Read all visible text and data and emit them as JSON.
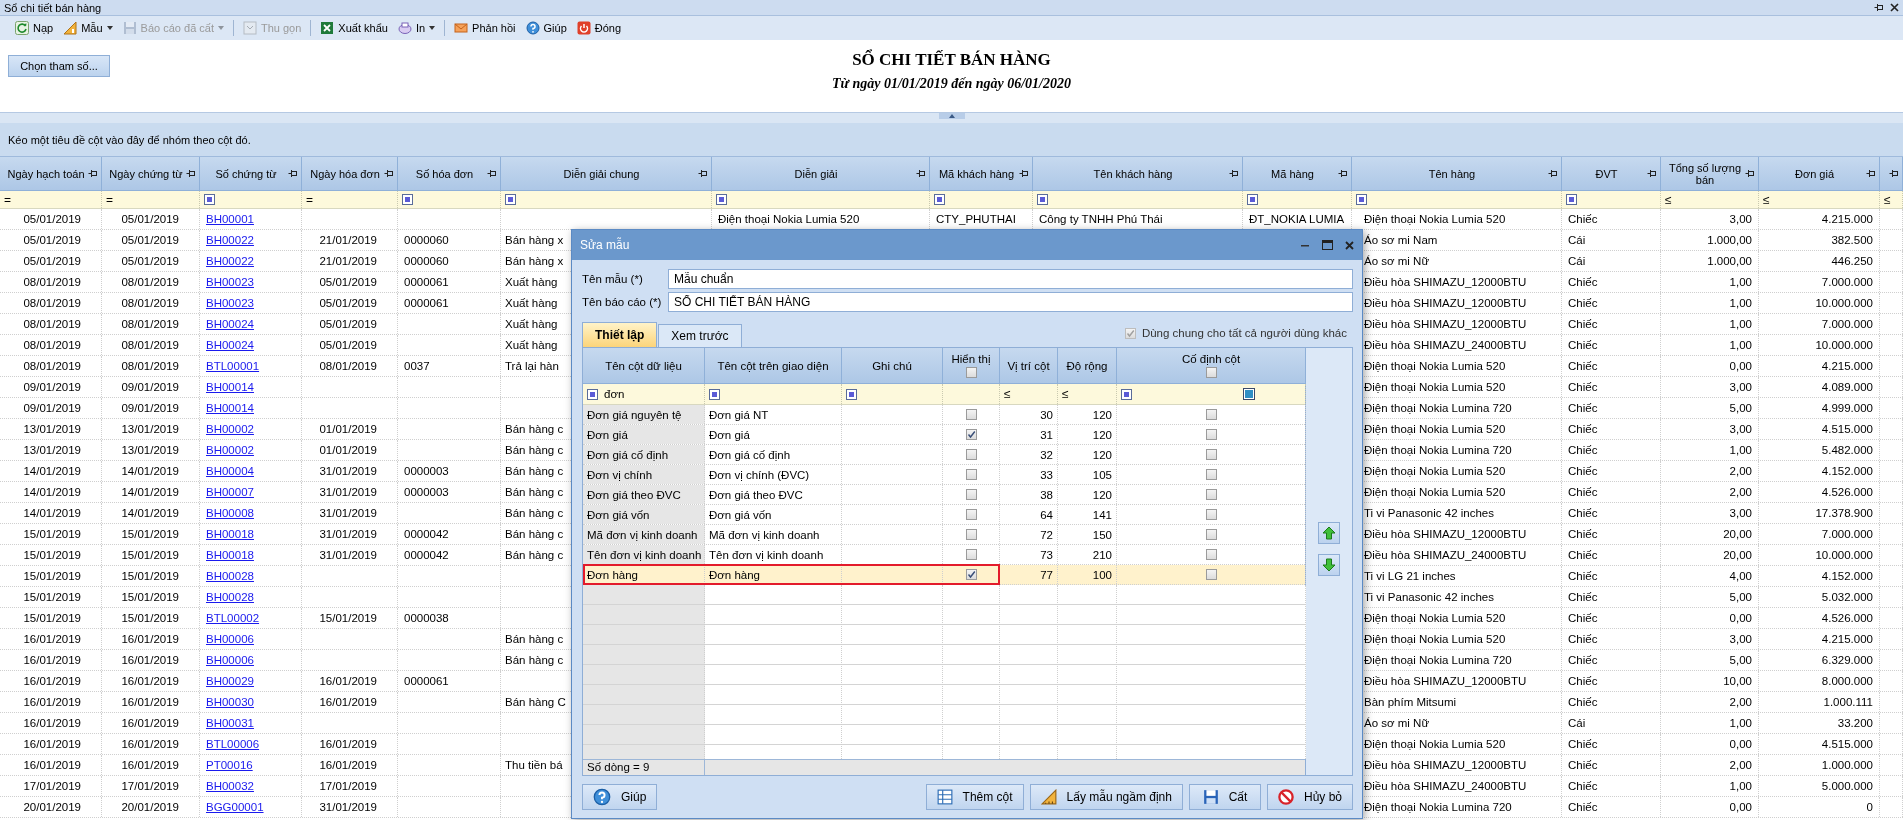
{
  "window": {
    "title": "Sổ chi tiết bán hàng"
  },
  "toolbar_groups": [
    {
      "items": [
        {
          "label": "Nạp",
          "disabled": false,
          "dropdown": false
        },
        {
          "label": "Mẫu",
          "disabled": false,
          "dropdown": true
        },
        {
          "label": "Báo cáo đã cất",
          "disabled": true,
          "dropdown": true
        }
      ]
    },
    {
      "items": [
        {
          "label": "Thu gọn",
          "disabled": true,
          "dropdown": false
        }
      ]
    },
    {
      "items": [
        {
          "label": "Xuất khẩu",
          "disabled": false,
          "dropdown": false
        },
        {
          "label": "In",
          "disabled": false,
          "dropdown": true
        }
      ]
    },
    {
      "items": [
        {
          "label": "Phản hồi",
          "disabled": false,
          "dropdown": false
        },
        {
          "label": "Giúp",
          "disabled": false,
          "dropdown": false
        },
        {
          "label": "Đóng",
          "disabled": false,
          "dropdown": false
        }
      ]
    }
  ],
  "header": {
    "button": "Chọn tham số...",
    "title": "SỔ CHI TIẾT BÁN HÀNG",
    "subtitle": "Từ ngày 01/01/2019 đến ngày 06/01/2020"
  },
  "group_panel": "Kéo một tiêu đề cột vào đây để nhóm theo cột đó.",
  "grid": {
    "columns": [
      {
        "label": "Ngày hạch toán",
        "kind": "date",
        "filter": "="
      },
      {
        "label": "Ngày chứng từ",
        "kind": "date",
        "filter": "="
      },
      {
        "label": "Số chứng từ",
        "kind": "link"
      },
      {
        "label": "Ngày hóa đơn",
        "kind": "date",
        "filter": "="
      },
      {
        "label": "Số hóa đơn",
        "kind": "text"
      },
      {
        "label": "Diễn giải chung",
        "kind": "text"
      },
      {
        "label": "Diễn giải",
        "kind": "text"
      },
      {
        "label": "Mã khách hàng",
        "kind": "text"
      },
      {
        "label": "Tên khách hàng",
        "kind": "text"
      },
      {
        "label": "Mã hàng",
        "kind": "text"
      },
      {
        "label": "Tên hàng",
        "kind": "text"
      },
      {
        "label": "ĐVT",
        "kind": "text"
      },
      {
        "label": "Tổng số lượng bán",
        "kind": "number",
        "filter": "≤"
      },
      {
        "label": "Đơn giá",
        "kind": "number",
        "filter": "≤"
      },
      {
        "kind": "number",
        "filter": "≤"
      }
    ],
    "rows": [
      {
        "cells": [
          "05/01/2019",
          "05/01/2019",
          "BH00001",
          null,
          null,
          null,
          "Điện thoại Nokia Lumia 520",
          "CTY_PHUTHAI",
          "Công ty TNHH Phú Thái",
          "ĐT_NOKIA LUMIA",
          "Điện thoại Nokia Lumia 520",
          "Chiếc",
          "3,00",
          "4.215.000",
          null
        ]
      },
      {
        "cells": [
          "05/01/2019",
          "05/01/2019",
          "BH00022",
          "21/01/2019",
          "0000060",
          "Bán hàng x",
          null,
          null,
          null,
          null,
          "Áo sơ mi Nam",
          "Cái",
          "1.000,00",
          "382.500",
          null
        ]
      },
      {
        "cells": [
          "05/01/2019",
          "05/01/2019",
          "BH00022",
          "21/01/2019",
          "0000060",
          "Bán hàng x",
          null,
          null,
          null,
          null,
          "Áo sơ mi Nữ",
          "Cái",
          "1.000,00",
          "446.250",
          null
        ]
      },
      {
        "cells": [
          "08/01/2019",
          "08/01/2019",
          "BH00023",
          "05/01/2019",
          "0000061",
          "Xuất hàng",
          null,
          null,
          null,
          null,
          "Điều hòa SHIMAZU_12000BTU",
          "Chiếc",
          "1,00",
          "7.000.000",
          null
        ]
      },
      {
        "cells": [
          "08/01/2019",
          "08/01/2019",
          "BH00023",
          "05/01/2019",
          "0000061",
          "Xuất hàng",
          null,
          null,
          null,
          null,
          "Điều hòa SHIMAZU_12000BTU",
          "Chiếc",
          "1,00",
          "10.000.000",
          null
        ]
      },
      {
        "cells": [
          "08/01/2019",
          "08/01/2019",
          "BH00024",
          "05/01/2019",
          null,
          "Xuất hàng",
          null,
          null,
          null,
          null,
          "Điều hòa SHIMAZU_12000BTU",
          "Chiếc",
          "1,00",
          "7.000.000",
          null
        ]
      },
      {
        "cells": [
          "08/01/2019",
          "08/01/2019",
          "BH00024",
          "05/01/2019",
          null,
          "Xuất hàng",
          null,
          null,
          null,
          null,
          "Điều hòa SHIMAZU_24000BTU",
          "Chiếc",
          "1,00",
          "10.000.000",
          null
        ]
      },
      {
        "cells": [
          "08/01/2019",
          "08/01/2019",
          "BTL00001",
          "08/01/2019",
          "0037",
          "Trả lại hàn",
          null,
          null,
          null,
          null,
          "Điện thoại Nokia Lumia 520",
          "Chiếc",
          "0,00",
          "4.215.000",
          null
        ]
      },
      {
        "cells": [
          "09/01/2019",
          "09/01/2019",
          "BH00014",
          null,
          null,
          null,
          null,
          null,
          null,
          null,
          "Điện thoại Nokia Lumia 520",
          "Chiếc",
          "3,00",
          "4.089.000",
          null
        ]
      },
      {
        "cells": [
          "09/01/2019",
          "09/01/2019",
          "BH00014",
          null,
          null,
          null,
          null,
          null,
          null,
          null,
          "Điện thoại Nokia Lumina 720",
          "Chiếc",
          "5,00",
          "4.999.000",
          null
        ]
      },
      {
        "cells": [
          "13/01/2019",
          "13/01/2019",
          "BH00002",
          "01/01/2019",
          null,
          "Bán hàng c",
          null,
          null,
          null,
          null,
          "Điện thoại Nokia Lumia 520",
          "Chiếc",
          "3,00",
          "4.515.000",
          null
        ]
      },
      {
        "cells": [
          "13/01/2019",
          "13/01/2019",
          "BH00002",
          "01/01/2019",
          null,
          "Bán hàng c",
          null,
          null,
          null,
          null,
          "Điện thoại Nokia Lumina 720",
          "Chiếc",
          "1,00",
          "5.482.000",
          null
        ]
      },
      {
        "cells": [
          "14/01/2019",
          "14/01/2019",
          "BH00004",
          "31/01/2019",
          "0000003",
          "Bán hàng c",
          null,
          null,
          null,
          null,
          "Điện thoại Nokia Lumia 520",
          "Chiếc",
          "2,00",
          "4.152.000",
          null
        ]
      },
      {
        "cells": [
          "14/01/2019",
          "14/01/2019",
          "BH00007",
          "31/01/2019",
          "0000003",
          "Bán hàng c",
          null,
          null,
          null,
          null,
          "Điện thoại Nokia Lumia 520",
          "Chiếc",
          "2,00",
          "4.526.000",
          null
        ]
      },
      {
        "cells": [
          "14/01/2019",
          "14/01/2019",
          "BH00008",
          "31/01/2019",
          null,
          "Bán hàng c",
          null,
          null,
          null,
          null,
          "Ti vi Panasonic 42 inches",
          "Chiếc",
          "3,00",
          "17.378.900",
          null
        ]
      },
      {
        "cells": [
          "15/01/2019",
          "15/01/2019",
          "BH00018",
          "31/01/2019",
          "0000042",
          "Bán hàng c",
          null,
          null,
          null,
          null,
          "Điều hòa SHIMAZU_12000BTU",
          "Chiếc",
          "20,00",
          "7.000.000",
          null
        ]
      },
      {
        "cells": [
          "15/01/2019",
          "15/01/2019",
          "BH00018",
          "31/01/2019",
          "0000042",
          "Bán hàng c",
          null,
          null,
          null,
          null,
          "Điều hòa SHIMAZU_24000BTU",
          "Chiếc",
          "20,00",
          "10.000.000",
          null
        ]
      },
      {
        "cells": [
          "15/01/2019",
          "15/01/2019",
          "BH00028",
          null,
          null,
          null,
          null,
          null,
          null,
          null,
          "Ti vi LG 21 inches",
          "Chiếc",
          "4,00",
          "4.152.000",
          null
        ]
      },
      {
        "cells": [
          "15/01/2019",
          "15/01/2019",
          "BH00028",
          null,
          null,
          null,
          null,
          null,
          null,
          null,
          "Ti vi Panasonic 42 inches",
          "Chiếc",
          "5,00",
          "5.032.000",
          null
        ]
      },
      {
        "cells": [
          "15/01/2019",
          "15/01/2019",
          "BTL00002",
          "15/01/2019",
          "0000038",
          null,
          null,
          null,
          null,
          null,
          "Điện thoại Nokia Lumia 520",
          "Chiếc",
          "0,00",
          "4.526.000",
          null
        ]
      },
      {
        "cells": [
          "16/01/2019",
          "16/01/2019",
          "BH00006",
          null,
          null,
          "Bán hàng c",
          null,
          null,
          null,
          null,
          "Điện thoại Nokia Lumia 520",
          "Chiếc",
          "3,00",
          "4.215.000",
          null
        ]
      },
      {
        "cells": [
          "16/01/2019",
          "16/01/2019",
          "BH00006",
          null,
          null,
          "Bán hàng c",
          null,
          null,
          null,
          null,
          "Điện thoại Nokia Lumina 720",
          "Chiếc",
          "5,00",
          "6.329.000",
          null
        ]
      },
      {
        "cells": [
          "16/01/2019",
          "16/01/2019",
          "BH00029",
          "16/01/2019",
          "0000061",
          null,
          null,
          null,
          null,
          null,
          "Điều hòa SHIMAZU_12000BTU",
          "Chiếc",
          "10,00",
          "8.000.000",
          null
        ]
      },
      {
        "cells": [
          "16/01/2019",
          "16/01/2019",
          "BH00030",
          "16/01/2019",
          null,
          "Bán hàng C",
          null,
          null,
          null,
          null,
          "Bàn phím Mitsumi",
          "Chiếc",
          "2,00",
          "1.000.111",
          null
        ]
      },
      {
        "cells": [
          "16/01/2019",
          "16/01/2019",
          "BH00031",
          null,
          null,
          null,
          null,
          null,
          null,
          null,
          "Áo sơ mi Nữ",
          "Cái",
          "1,00",
          "33.200",
          null
        ]
      },
      {
        "cells": [
          "16/01/2019",
          "16/01/2019",
          "BTL00006",
          "16/01/2019",
          null,
          null,
          null,
          null,
          null,
          null,
          "Điện thoại Nokia Lumia 520",
          "Chiếc",
          "0,00",
          "4.515.000",
          null
        ]
      },
      {
        "cells": [
          "16/01/2019",
          "16/01/2019",
          "PT00016",
          "16/01/2019",
          null,
          "Thu tiền bá",
          null,
          null,
          null,
          null,
          "Điều hòa SHIMAZU_12000BTU",
          "Chiếc",
          "2,00",
          "1.000.000",
          null
        ]
      },
      {
        "cells": [
          "17/01/2019",
          "17/01/2019",
          "BH00032",
          "17/01/2019",
          null,
          null,
          null,
          null,
          null,
          null,
          "Điều hòa SHIMAZU_24000BTU",
          "Chiếc",
          "1,00",
          "5.000.000",
          null
        ]
      },
      {
        "cells": [
          "20/01/2019",
          "20/01/2019",
          "BGG00001",
          "31/01/2019",
          null,
          null,
          null,
          null,
          null,
          null,
          "Điện thoại Nokia Lumina 720",
          "Chiếc",
          "0,00",
          "0",
          null
        ]
      }
    ]
  },
  "dialog": {
    "title": "Sửa mẫu",
    "fields": [
      {
        "label": "Tên mẫu (*)",
        "value": "Mẫu chuẩn"
      },
      {
        "label": "Tên báo cáo (*)",
        "value": "SỔ CHI TIẾT BÁN HÀNG"
      }
    ],
    "tabs": [
      {
        "label": "Thiết lập",
        "selected": true
      },
      {
        "label": "Xem trước",
        "selected": false
      }
    ],
    "share_option": {
      "label": "Dùng chung cho tất cả người dùng khác",
      "checked": true,
      "disabled": true
    },
    "columns": [
      {
        "label": "Tên cột dữ liệu",
        "kind": "text",
        "filter_value": "đơn"
      },
      {
        "label": "Tên cột trên giao diện",
        "kind": "text"
      },
      {
        "label": "Ghi chú",
        "kind": "text"
      },
      {
        "label": "Hiển thị",
        "kind": "check",
        "header_checked": false
      },
      {
        "label": "Vị trí cột",
        "kind": "number",
        "filter": "≤"
      },
      {
        "label": "Độ rộng",
        "kind": "number",
        "filter": "≤"
      },
      {
        "label": "Cố định cột",
        "kind": "check",
        "header_checked": false
      }
    ],
    "rows": [
      {
        "cells": [
          "Đơn giá nguyên tệ",
          "Đơn giá NT",
          null,
          false,
          "30",
          "120",
          false
        ],
        "selected": false,
        "marked": false
      },
      {
        "cells": [
          "Đơn giá",
          "Đơn giá",
          null,
          true,
          "31",
          "120",
          false
        ],
        "selected": false,
        "marked": false
      },
      {
        "cells": [
          "Đơn giá cố định",
          "Đơn giá cố định",
          null,
          false,
          "32",
          "120",
          false
        ],
        "selected": false,
        "marked": false
      },
      {
        "cells": [
          "Đơn vị chính",
          "Đơn vị chính (ĐVC)",
          null,
          false,
          "33",
          "105",
          false
        ],
        "selected": false,
        "marked": false
      },
      {
        "cells": [
          "Đơn giá theo ĐVC",
          "Đơn giá theo ĐVC",
          null,
          false,
          "38",
          "120",
          false
        ],
        "selected": false,
        "marked": false
      },
      {
        "cells": [
          "Đơn giá vốn",
          "Đơn giá vốn",
          null,
          false,
          "64",
          "141",
          false
        ],
        "selected": false,
        "marked": false
      },
      {
        "cells": [
          "Mã đơn vị kinh doanh",
          "Mã đơn vị kinh doanh",
          null,
          false,
          "72",
          "150",
          false
        ],
        "selected": false,
        "marked": false
      },
      {
        "cells": [
          "Tên đơn vị kinh doanh",
          "Tên đơn vị kinh doanh",
          null,
          false,
          "73",
          "210",
          false
        ],
        "selected": false,
        "marked": false
      },
      {
        "cells": [
          "Đơn hàng",
          "Đơn hàng",
          null,
          true,
          "77",
          "100",
          false
        ],
        "selected": true,
        "marked": true
      }
    ],
    "row_count": "Số dòng = 9",
    "buttons": [
      {
        "label": "Giúp"
      },
      {
        "label": "Thêm cột"
      },
      {
        "label": "Lấy mẫu ngầm định"
      },
      {
        "label": "Cất"
      },
      {
        "label": "Hủy bỏ"
      }
    ]
  }
}
